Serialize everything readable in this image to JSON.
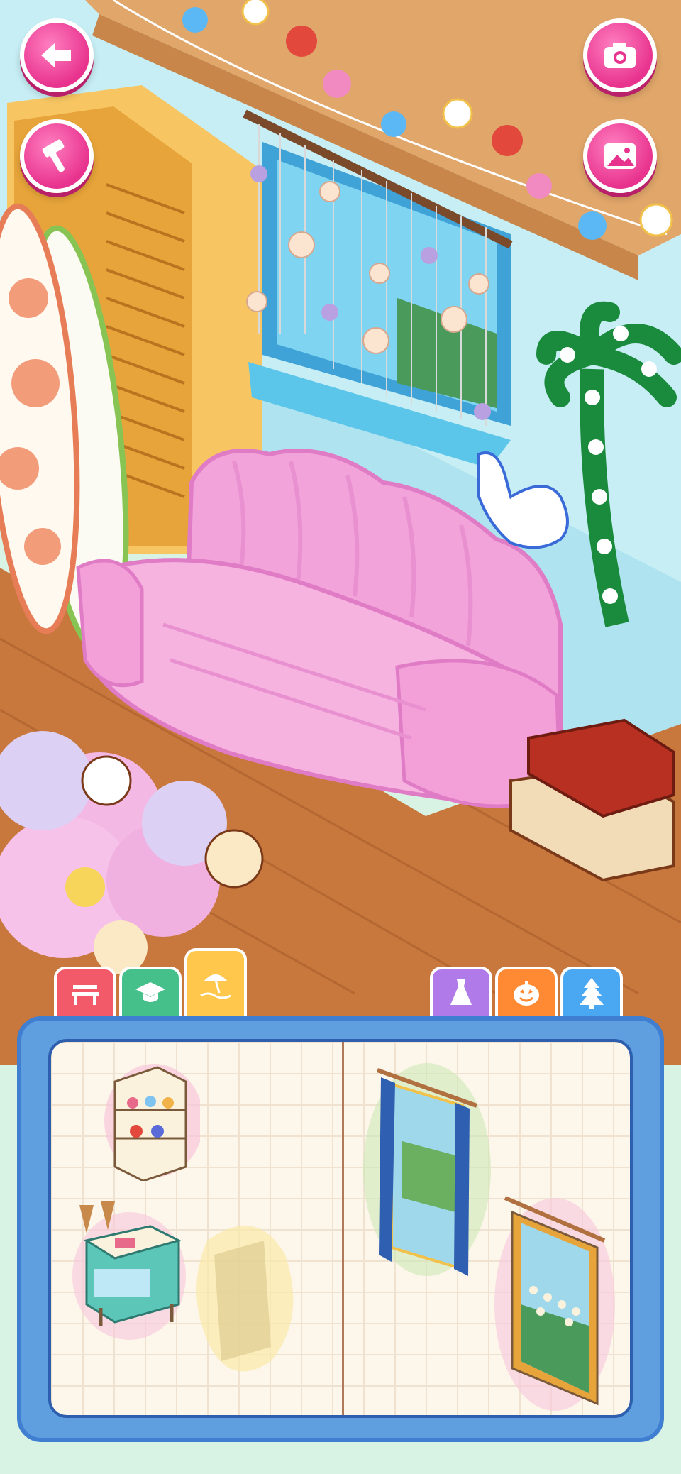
{
  "topbar": {
    "back_icon": "arrow-left-icon",
    "build_icon": "hammer-icon",
    "camera_icon": "camera-icon",
    "gallery_icon": "image-icon"
  },
  "colors": {
    "accent_pink": "#e8338e",
    "panel_blue": "#5f9fe0",
    "wall": "#c9eef0",
    "floor": "#c9773f"
  },
  "category_tabs": [
    {
      "icon": "bench-icon",
      "color": "#f25a6a",
      "selected": false
    },
    {
      "icon": "graduation-cap-icon",
      "color": "#46c08a",
      "selected": false
    },
    {
      "icon": "beach-umbrella-icon",
      "color": "#ffc84d",
      "selected": true
    },
    {
      "icon": "dress-icon",
      "color": "#b07be8",
      "selected": false
    },
    {
      "icon": "pumpkin-icon",
      "color": "#ff8a33",
      "selected": false
    },
    {
      "icon": "pine-tree-icon",
      "color": "#4aa7f2",
      "selected": false
    }
  ],
  "catalog_items": [
    {
      "name": "flower-shelf",
      "icon": "shelf-icon"
    },
    {
      "name": "ice-cream-cart",
      "icon": "ice-cream-cart-icon"
    },
    {
      "name": "locked-placeholder",
      "icon": "placeholder-icon"
    },
    {
      "name": "curtain-window",
      "icon": "window-icon"
    },
    {
      "name": "seashell-curtain-window",
      "icon": "window-icon"
    }
  ]
}
